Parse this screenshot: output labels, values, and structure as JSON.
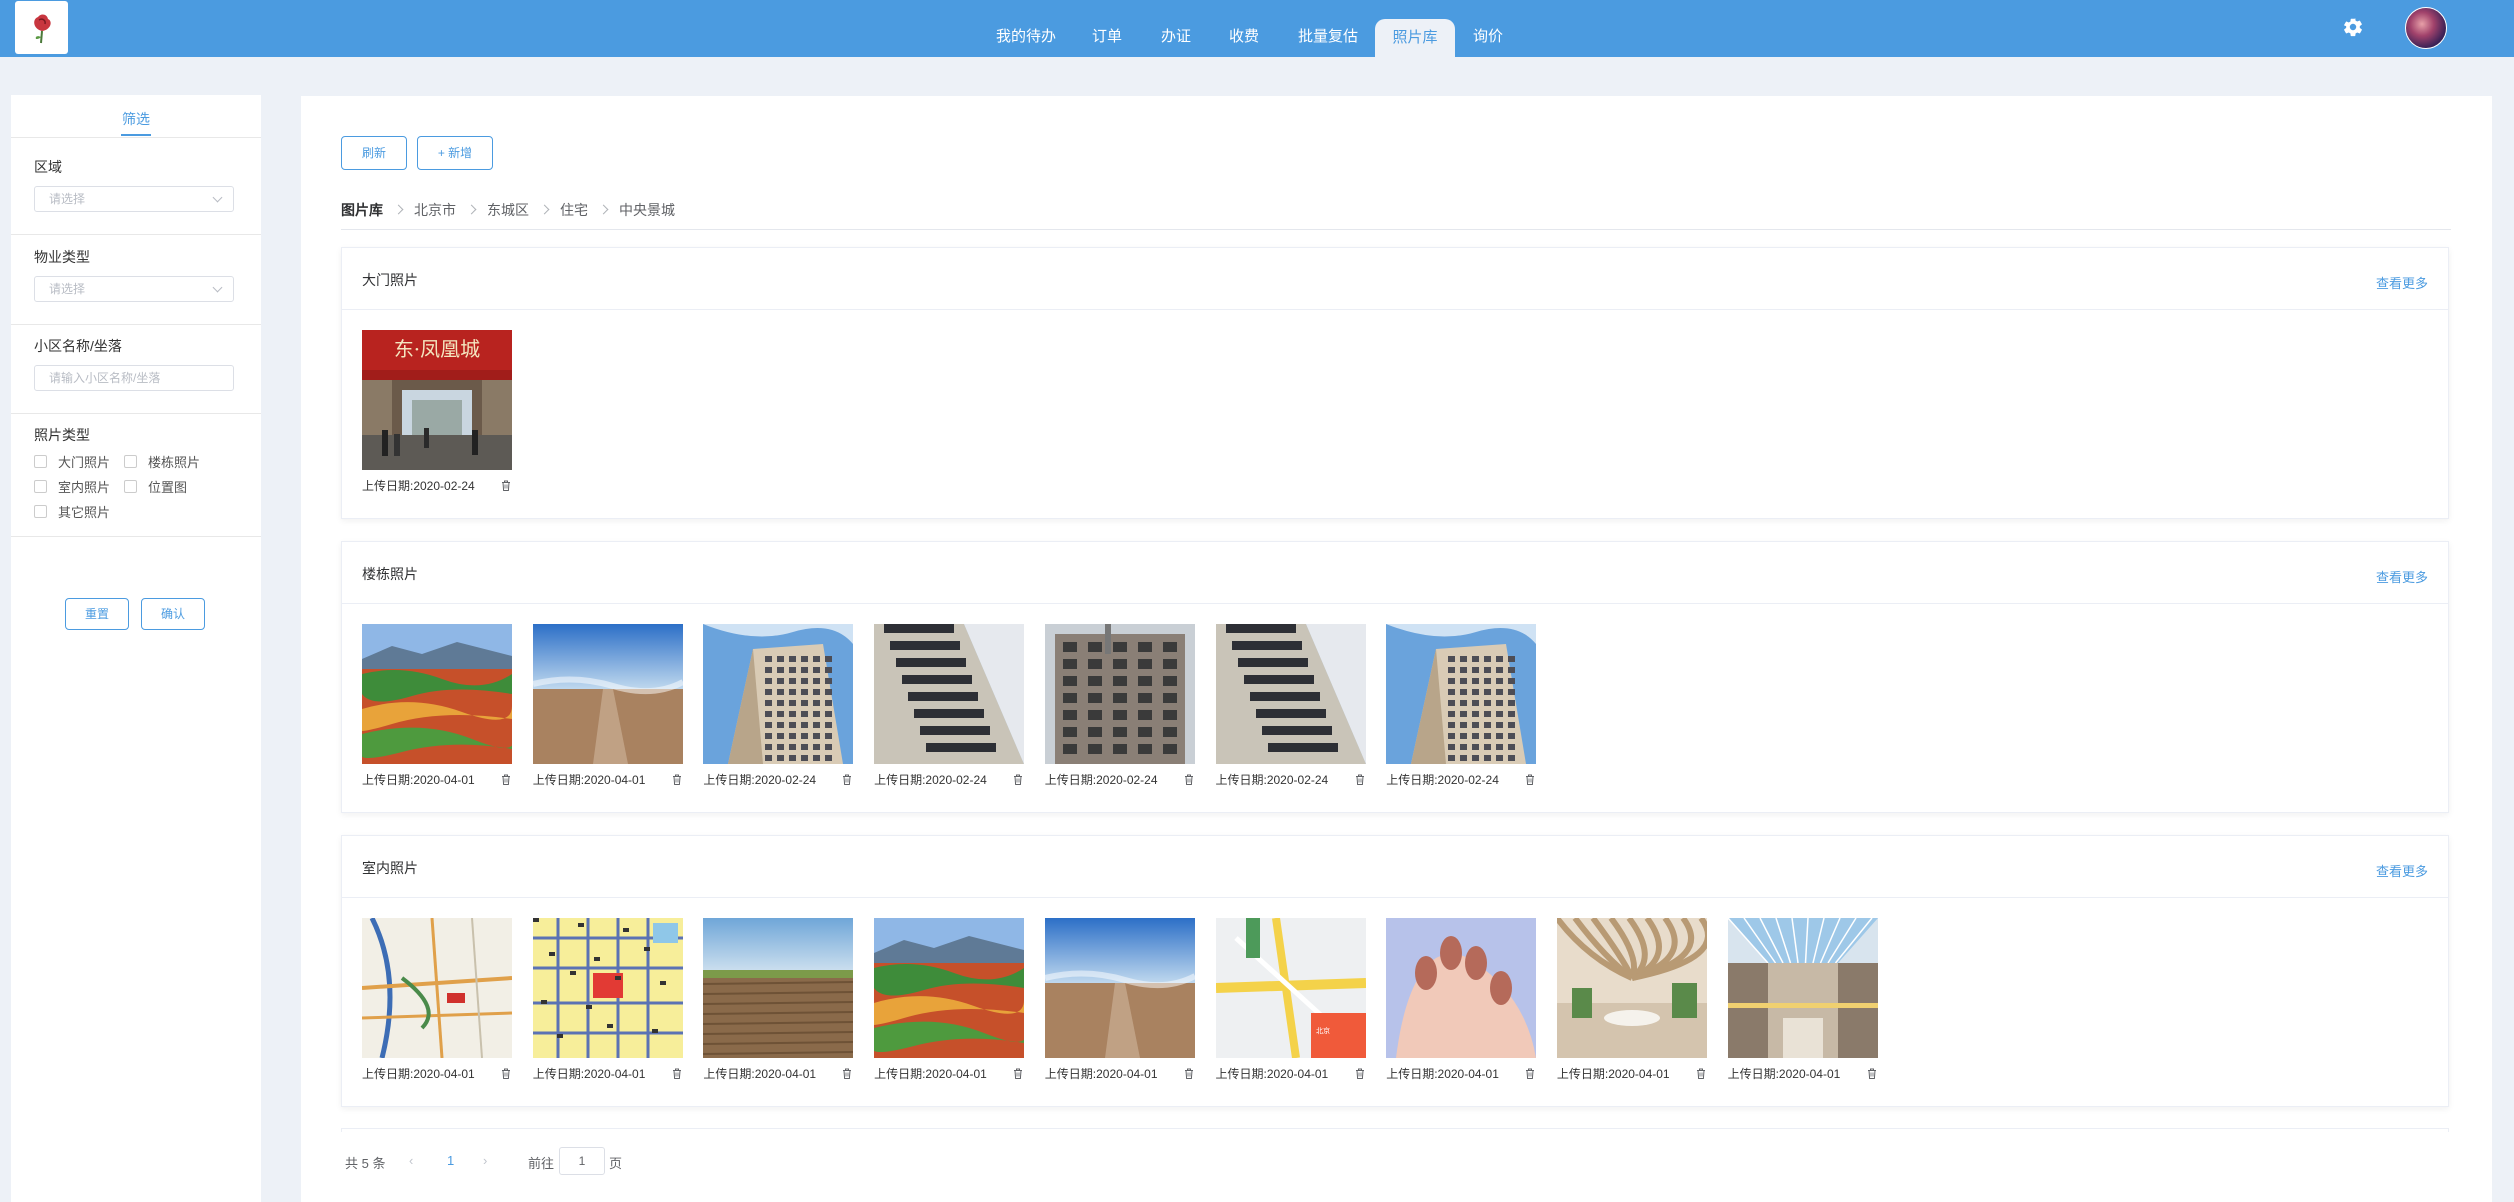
{
  "header": {
    "nav": [
      {
        "label": "我的待办",
        "active": false
      },
      {
        "label": "订单",
        "active": false
      },
      {
        "label": "办证",
        "active": false
      },
      {
        "label": "收费",
        "active": false
      },
      {
        "label": "批量复估",
        "active": false
      },
      {
        "label": "照片库",
        "active": true
      },
      {
        "label": "询价",
        "active": false
      }
    ],
    "icons": {
      "logo": "rose-logo-icon",
      "settings": "gear-icon",
      "avatar": "user-avatar"
    }
  },
  "filter": {
    "tab": "筛选",
    "region": {
      "label": "区域",
      "placeholder": "请选择"
    },
    "property_type": {
      "label": "物业类型",
      "placeholder": "请选择"
    },
    "community": {
      "label": "小区名称/坐落",
      "placeholder": "请输入小区名称/坐落"
    },
    "photo_type": {
      "label": "照片类型",
      "options": [
        "大门照片",
        "楼栋照片",
        "室内照片",
        "位置图",
        "其它照片"
      ]
    },
    "reset_label": "重置",
    "confirm_label": "确认"
  },
  "toolbar": {
    "refresh_label": "刷新",
    "add_label": "+ 新增"
  },
  "breadcrumb": [
    "图片库",
    "北京市",
    "东城区",
    "住宅",
    "中央景城"
  ],
  "sections": [
    {
      "title": "大门照片",
      "more": "查看更多",
      "photos": [
        {
          "caption": "上传日期:2020-02-24",
          "kind": "gate"
        }
      ]
    },
    {
      "title": "楼栋照片",
      "more": "查看更多",
      "photos": [
        {
          "caption": "上传日期:2020-04-01",
          "kind": "fields"
        },
        {
          "caption": "上传日期:2020-04-01",
          "kind": "plain"
        },
        {
          "caption": "上传日期:2020-02-24",
          "kind": "building"
        },
        {
          "caption": "上传日期:2020-02-24",
          "kind": "building-dark"
        },
        {
          "caption": "上传日期:2020-02-24",
          "kind": "building-old"
        },
        {
          "caption": "上传日期:2020-02-24",
          "kind": "building-dark"
        },
        {
          "caption": "上传日期:2020-02-24",
          "kind": "building"
        }
      ]
    },
    {
      "title": "室内照片",
      "more": "查看更多",
      "photos": [
        {
          "caption": "上传日期:2020-04-01",
          "kind": "map"
        },
        {
          "caption": "上传日期:2020-04-01",
          "kind": "map-yellow"
        },
        {
          "caption": "上传日期:2020-04-01",
          "kind": "soil"
        },
        {
          "caption": "上传日期:2020-04-01",
          "kind": "fields"
        },
        {
          "caption": "上传日期:2020-04-01",
          "kind": "plain"
        },
        {
          "caption": "上传日期:2020-04-01",
          "kind": "map-light"
        },
        {
          "caption": "上传日期:2020-04-01",
          "kind": "nails"
        },
        {
          "caption": "上传日期:2020-04-01",
          "kind": "interior"
        },
        {
          "caption": "上传日期:2020-04-01",
          "kind": "mall"
        }
      ]
    }
  ],
  "pagination": {
    "total": "共 5 条",
    "current": "1",
    "goto_prefix": "前往",
    "goto_value": "1",
    "goto_suffix": "页"
  }
}
